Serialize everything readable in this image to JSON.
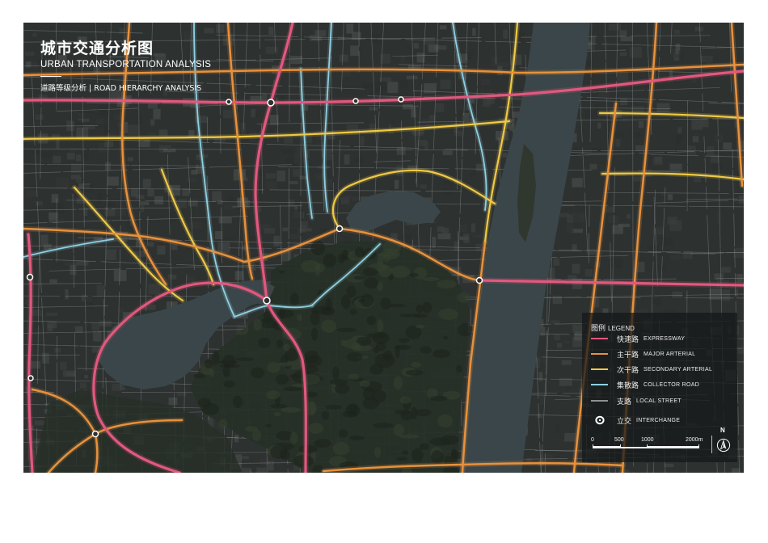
{
  "header": {
    "title_cn": "城市交通分析图",
    "title_en": "URBAN TRANSPORTATION ANALYSIS",
    "subtitle": "道路等级分析 | ROAD HIERARCHY ANALYSIS"
  },
  "legend": {
    "title_cn": "图例",
    "title_en": "LEGEND",
    "items": [
      {
        "cn": "快速路",
        "en": "EXPRESSWAY",
        "color": "#e2587e"
      },
      {
        "cn": "主干路",
        "en": "MAJOR ARTERIAL",
        "color": "#e8913c"
      },
      {
        "cn": "次干路",
        "en": "SECONDARY ARTERIAL",
        "color": "#efca45"
      },
      {
        "cn": "集散路",
        "en": "COLLECTOR ROAD",
        "color": "#8fd0e2"
      },
      {
        "cn": "支路",
        "en": "LOCAL STREET",
        "color": "#8d9191"
      },
      {
        "cn": "立交",
        "en": "INTERCHANGE",
        "icon": "interchange-icon"
      }
    ]
  },
  "scale_bar": {
    "labels": [
      "0",
      "500",
      "1000",
      "2000m"
    ]
  },
  "north": {
    "label": "N",
    "icon": "north-arrow-icon"
  },
  "map_colors": {
    "land": "#2d3130",
    "water": "#3a4649",
    "green": "#263027"
  }
}
